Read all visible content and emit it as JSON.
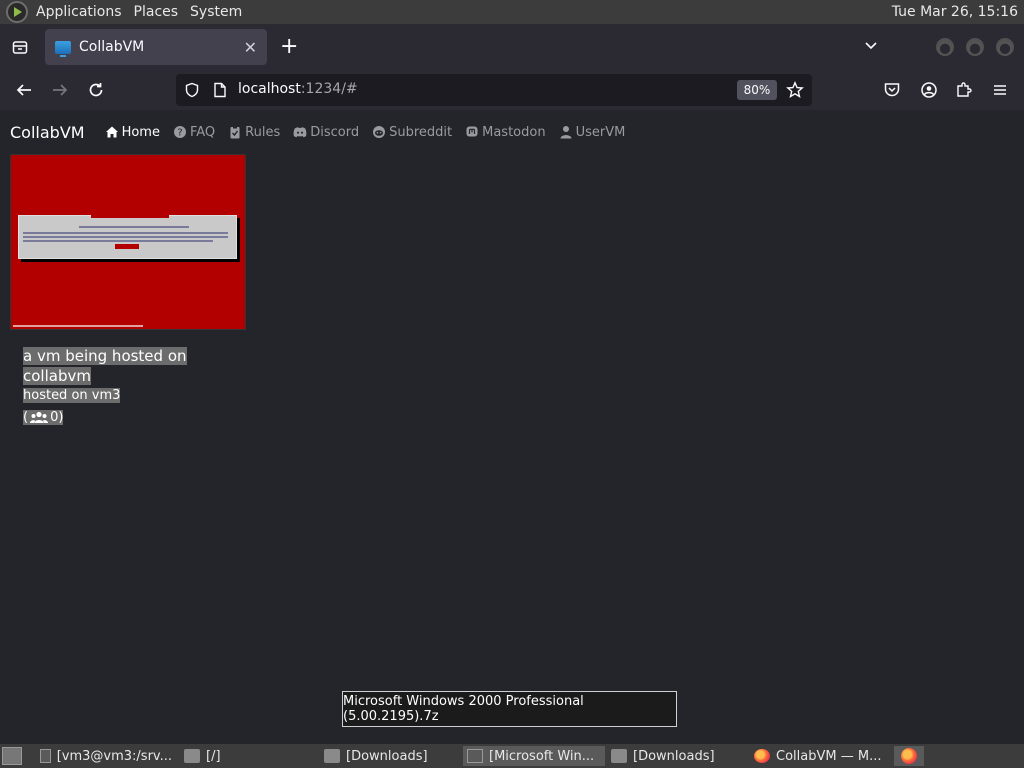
{
  "top_panel": {
    "menus": [
      "Applications",
      "Places",
      "System"
    ],
    "clock": "Tue Mar 26, 15:16"
  },
  "browser": {
    "tab_title": "CollabVM",
    "url_host": "localhost",
    "url_rest": ":1234/#",
    "zoom": "80%"
  },
  "site": {
    "brand": "CollabVM",
    "nav": [
      {
        "label": "Home",
        "icon": "home-icon"
      },
      {
        "label": "FAQ",
        "icon": "question-icon"
      },
      {
        "label": "Rules",
        "icon": "clipboard-icon"
      },
      {
        "label": "Discord",
        "icon": "discord-icon"
      },
      {
        "label": "Subreddit",
        "icon": "reddit-icon"
      },
      {
        "label": "Mastodon",
        "icon": "mastodon-icon"
      },
      {
        "label": "UserVM",
        "icon": "user-icon"
      }
    ]
  },
  "vm_card": {
    "title_line1": "a vm being hosted on",
    "title_line2": "collabvm",
    "host": "hosted on vm3",
    "user_count_prefix": "(",
    "user_count": "0)"
  },
  "tooltip": "Microsoft Windows 2000 Professional (5.00.2195).7z",
  "taskbar": {
    "tasks": [
      {
        "label": "[vm3@vm3:/srv..."
      },
      {
        "label": "[/]"
      },
      {
        "label": "[Downloads]"
      },
      {
        "label": "[Microsoft Win..."
      },
      {
        "label": "[Downloads]"
      },
      {
        "label": "CollabVM — M..."
      }
    ]
  }
}
